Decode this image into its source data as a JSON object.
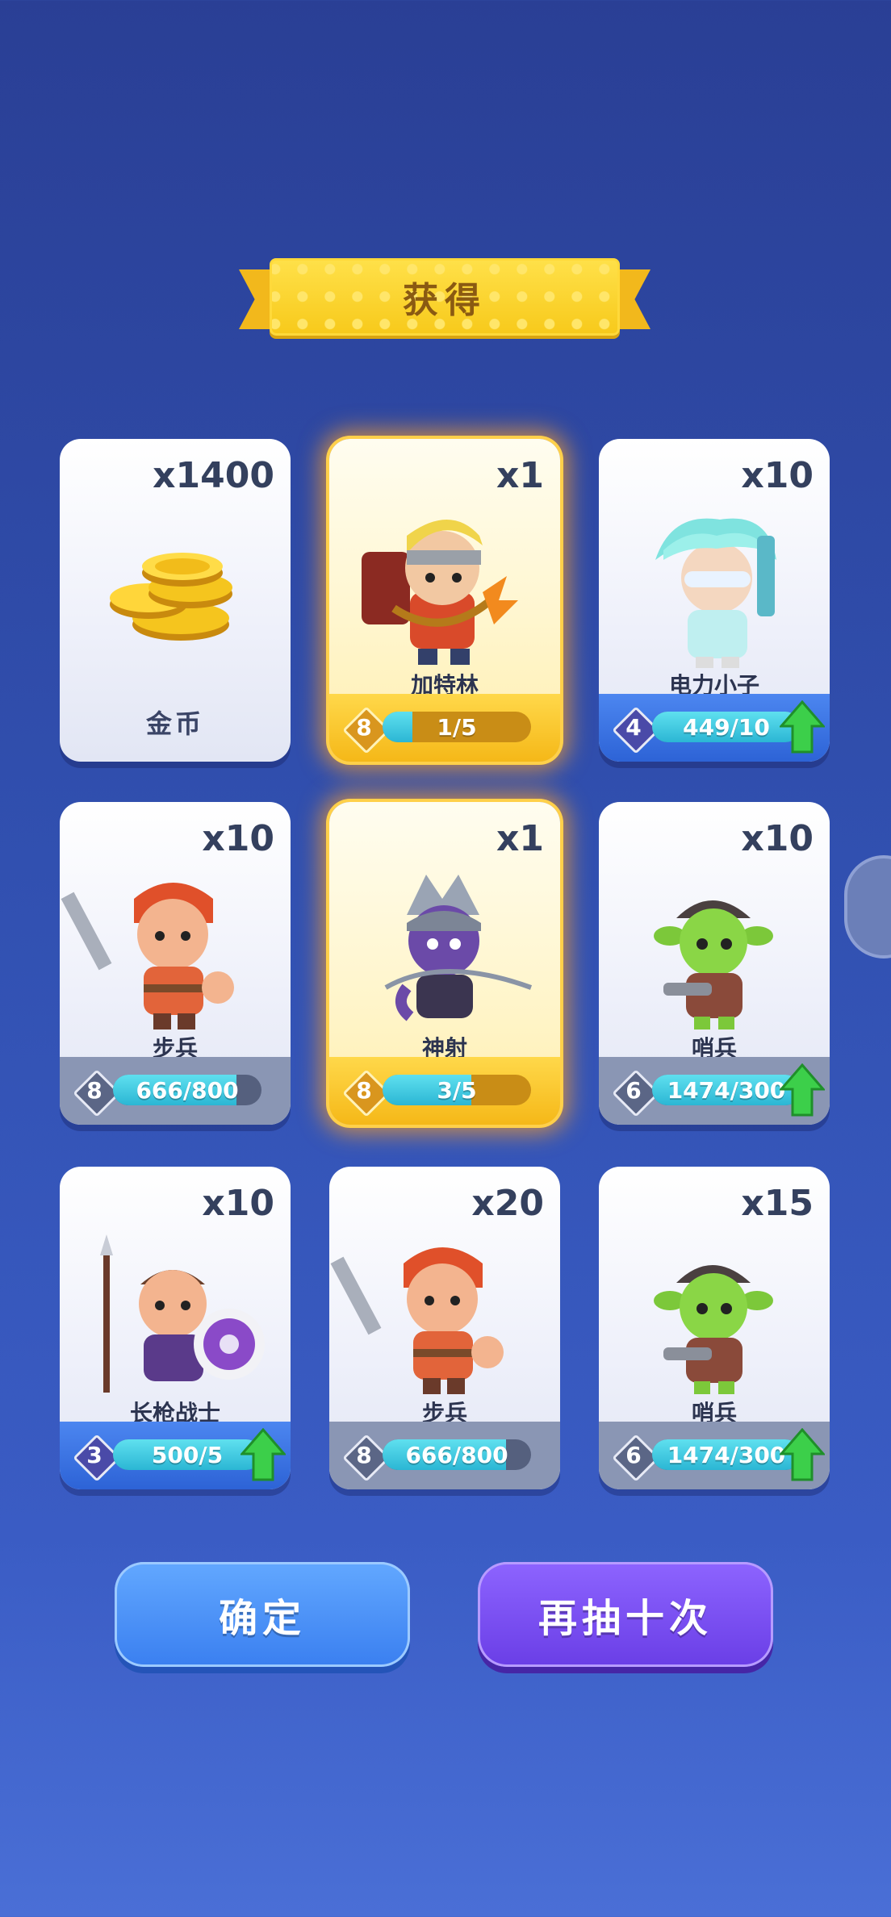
{
  "header": {
    "title": "获得"
  },
  "cards": [
    {
      "qty": "x1400",
      "name": "金币",
      "type": "coin"
    },
    {
      "qty": "x1",
      "name": "加特林",
      "level": "8",
      "progress": "1/5",
      "fill": 0.2,
      "style": "gold",
      "upgrade": false
    },
    {
      "qty": "x10",
      "name": "电力小子",
      "level": "4",
      "progress": "449/10",
      "fill": 1.0,
      "style": "blue",
      "upgrade": true
    },
    {
      "qty": "x10",
      "name": "步兵",
      "level": "8",
      "progress": "666/800",
      "fill": 0.83,
      "style": "gray",
      "upgrade": false
    },
    {
      "qty": "x1",
      "name": "神射",
      "level": "8",
      "progress": "3/5",
      "fill": 0.6,
      "style": "gold",
      "upgrade": false
    },
    {
      "qty": "x10",
      "name": "哨兵",
      "level": "6",
      "progress": "1474/300",
      "fill": 1.0,
      "style": "gray",
      "upgrade": true
    },
    {
      "qty": "x10",
      "name": "长枪战士",
      "level": "3",
      "progress": "500/5",
      "fill": 1.0,
      "style": "blue",
      "upgrade": true
    },
    {
      "qty": "x20",
      "name": "步兵",
      "level": "8",
      "progress": "666/800",
      "fill": 0.83,
      "style": "gray",
      "upgrade": false
    },
    {
      "qty": "x15",
      "name": "哨兵",
      "level": "6",
      "progress": "1474/300",
      "fill": 1.0,
      "style": "gray",
      "upgrade": true
    }
  ],
  "buttons": {
    "confirm": "确定",
    "draw_again": "再抽十次"
  },
  "colors": {
    "gold_glow": "#ffa028",
    "upgrade_arrow": "#3ccf4a",
    "confirm": "#3a7ff0",
    "draw_again": "#6a3ee6"
  },
  "icons": {
    "level": "diamond-level-icon",
    "upgrade": "green-up-arrow-icon",
    "coin": "gold-coin-stack-icon"
  }
}
